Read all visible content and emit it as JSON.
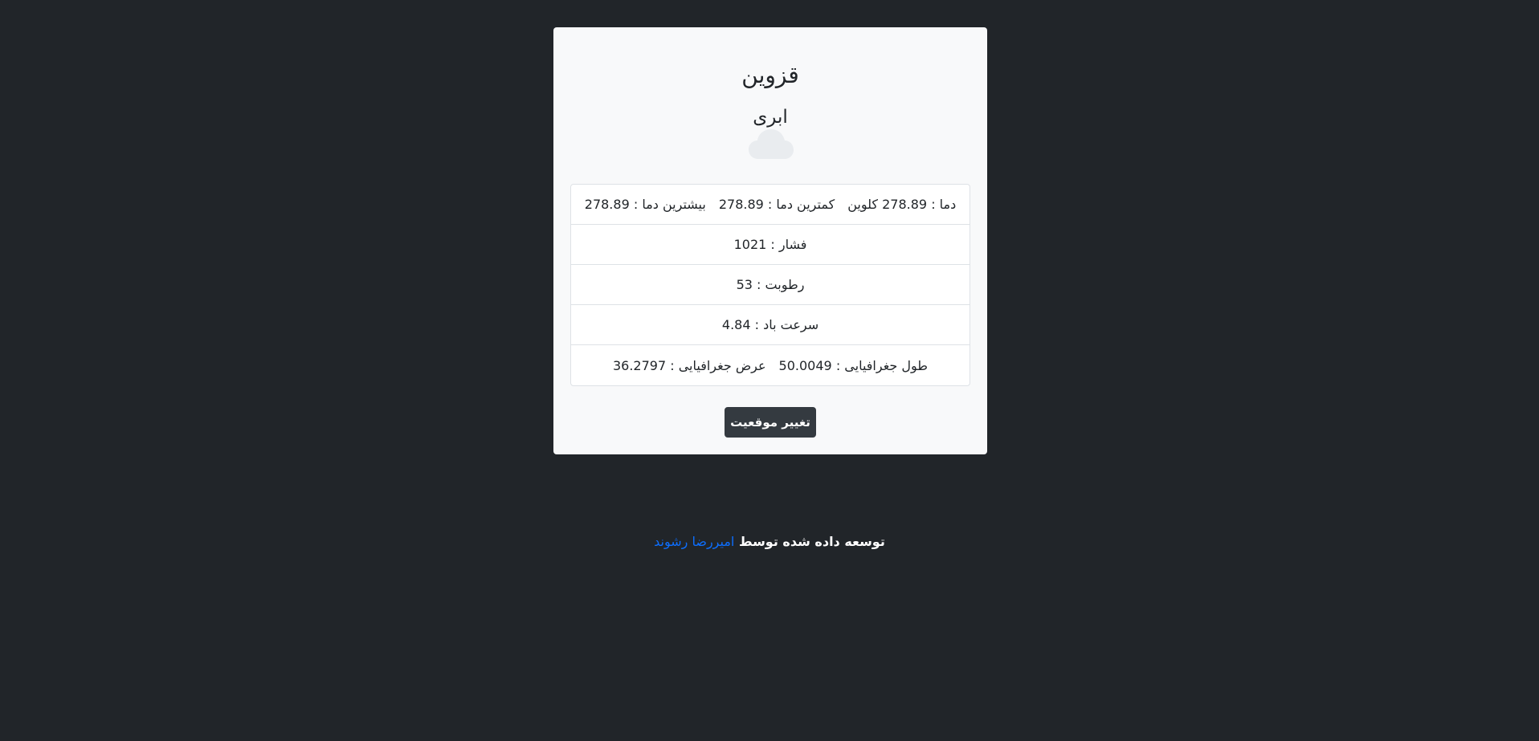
{
  "card": {
    "city": "قزوین",
    "condition": "ابری",
    "icon": "cloud-icon"
  },
  "rows": {
    "temp": {
      "label": "دما :",
      "value": "278.89",
      "unit": "کلوین"
    },
    "temp_min": {
      "label": "کمترین دما :",
      "value": "278.89"
    },
    "temp_max": {
      "label": "بیشترین دما :",
      "value": "278.89"
    },
    "pressure": {
      "label": "فشار :",
      "value": "1021"
    },
    "humidity": {
      "label": "رطوبت :",
      "value": "53"
    },
    "wind": {
      "label": "سرعت باد :",
      "value": "4.84"
    },
    "lon": {
      "label": "طول جغرافیایی :",
      "value": "50.0049"
    },
    "lat": {
      "label": "عرض جغرافیایی :",
      "value": "36.2797"
    }
  },
  "button": {
    "label": "تغییر موقعیت"
  },
  "footer": {
    "text": "توسعه داده شده توسط",
    "author": "امیررضا رشوند"
  },
  "colors": {
    "background": "#212529",
    "card": "#f8f9fa",
    "button": "#343a40",
    "link": "#0d6efd"
  }
}
